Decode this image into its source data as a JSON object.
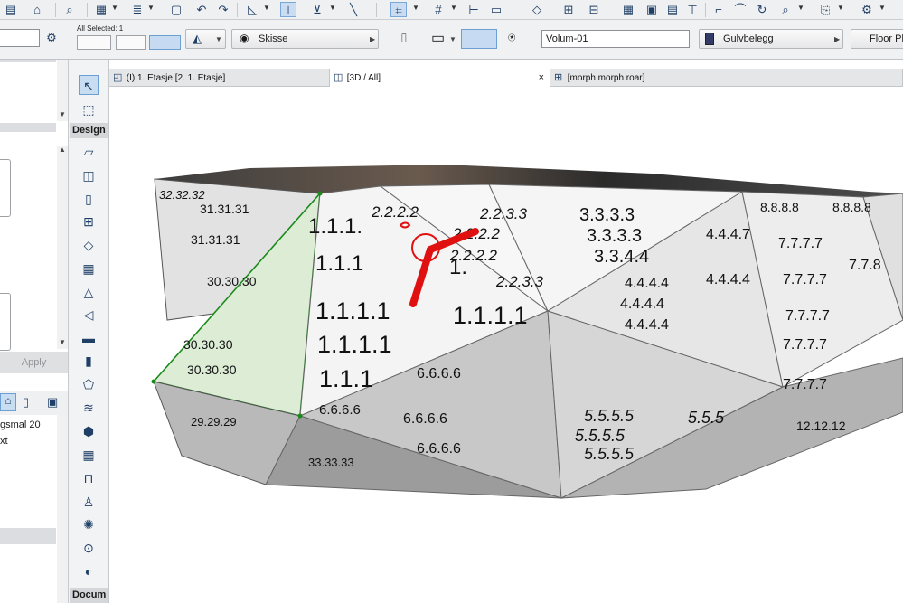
{
  "infobox": {
    "selection_label": "All Selected: 1",
    "structure_label": "Skisse",
    "id_value": "Volum-01",
    "material_label": "Gulvbelegg",
    "floor_plan_label": "Floor Pl"
  },
  "left_panel": {
    "apply_label": "Apply",
    "partial_text_1": "gsmal 20",
    "partial_text_2": "xt"
  },
  "toolbox": {
    "design_label": "Design",
    "docum_label": "Docum"
  },
  "tabs": [
    {
      "label": "(I) 1. Etasje [2. 1. Etasje]",
      "icon": "floor-plan-icon"
    },
    {
      "label": "[3D / All]",
      "icon": "3d-cube-icon"
    },
    {
      "label": "[morph morph roar]",
      "icon": "grid-icon"
    }
  ],
  "tab_close": "×",
  "model_texture": {
    "labels": [
      "1.1.1.1",
      "1.1.1.1",
      "1.1.1.1",
      "1.1.1.",
      "1.1.1",
      "1.",
      "2.2.2.2",
      "2.2.2.2",
      "2.2.3.3",
      "2.2.3.3",
      "3.3.3.3",
      "3.3.3.3",
      "3.3.4.4",
      "4.4.4.4",
      "4.4.4.4",
      "4.4.4.4",
      "4.4.4.7",
      "5.5.5.5",
      "5.5.5.5",
      "5.5.5.5",
      "5.5.5",
      "6.6.6.6",
      "6.6.6.6",
      "6.6.6.6",
      "7.7.7.7",
      "7.7.7.7",
      "7.7.8",
      "8.8.8.8",
      "8.8.8.8",
      "30.30.30",
      "31.31.31",
      "12.12.12",
      "29.29.29",
      "32.32.32",
      "33.33.33"
    ]
  },
  "colors": {
    "accent": "#c8dcf2",
    "selection_edge": "#1a8a1a",
    "selection_fill": "#d9ecd2",
    "marker": "#e01010"
  }
}
